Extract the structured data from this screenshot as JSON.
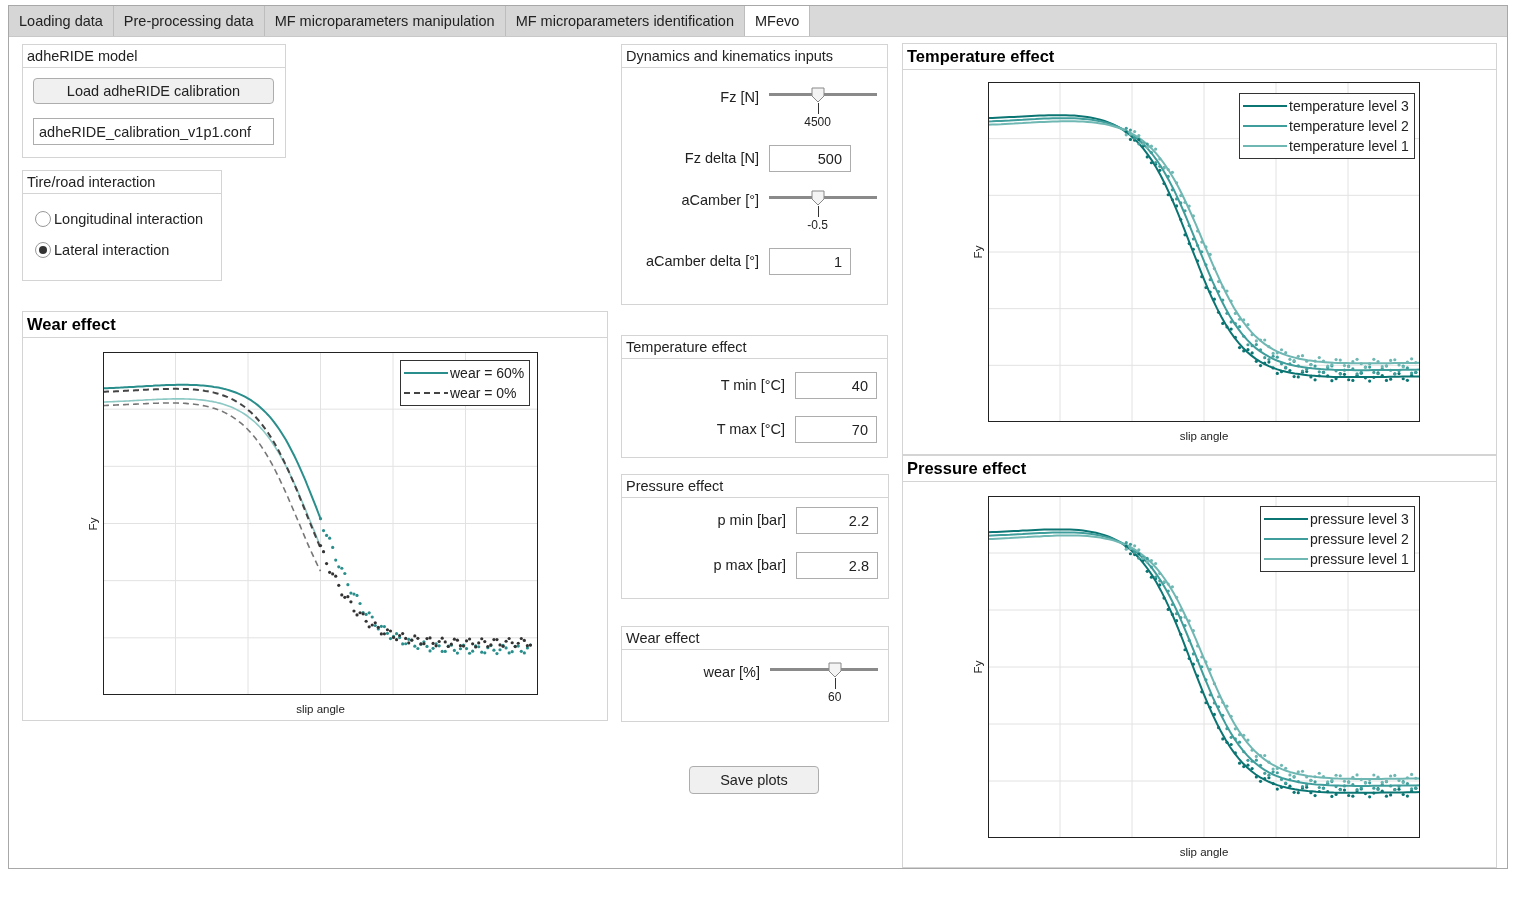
{
  "tabs": [
    {
      "label": "Loading data",
      "selected": false
    },
    {
      "label": "Pre-processing data",
      "selected": false
    },
    {
      "label": "MF microparameters manipulation",
      "selected": false
    },
    {
      "label": "MF microparameters identification",
      "selected": false
    },
    {
      "label": "MFevo",
      "selected": true
    }
  ],
  "model_panel": {
    "title": "adheRIDE model",
    "button": "Load adheRIDE calibration",
    "file_field": "adheRIDE_calibration_v1p1.conf"
  },
  "interaction_panel": {
    "title": "Tire/road interaction",
    "options": [
      {
        "label": "Longitudinal interaction",
        "selected": false
      },
      {
        "label": "Lateral interaction",
        "selected": true
      }
    ]
  },
  "wear_chart": {
    "title": "Wear effect",
    "ylabel": "Fy",
    "xlabel": "slip angle",
    "legend": [
      {
        "label": "wear = 60%",
        "kind": "solid",
        "color": "#2a8f8c"
      },
      {
        "label": "wear = 0%",
        "kind": "dashed",
        "color": "#444444"
      }
    ]
  },
  "dynamics_panel": {
    "title": "Dynamics and kinematics inputs",
    "inputs": [
      {
        "kind": "slider",
        "label": "Fz [N]",
        "level": 0.45,
        "reading": "4500"
      },
      {
        "kind": "field",
        "label": "Fz delta [N]",
        "value": "500"
      },
      {
        "kind": "slider",
        "label": "aCamber [°]",
        "level": 0.45,
        "reading": "-0.5"
      },
      {
        "kind": "field",
        "label": "aCamber delta [°]",
        "value": "1"
      }
    ]
  },
  "temperature_panel": {
    "title": "Temperature effect",
    "inputs": [
      {
        "kind": "field",
        "label": "T min [°C]",
        "value": "40"
      },
      {
        "kind": "field",
        "label": "T max [°C]",
        "value": "70"
      }
    ]
  },
  "pressure_panel": {
    "title": "Pressure effect",
    "inputs": [
      {
        "kind": "field",
        "label": "p min [bar]",
        "value": "2.2"
      },
      {
        "kind": "field",
        "label": "p max [bar]",
        "value": "2.8"
      }
    ]
  },
  "wear_panel": {
    "title": "Wear effect",
    "inputs": [
      {
        "kind": "slider",
        "label": "wear [%]",
        "level": 0.6,
        "reading": "60"
      }
    ]
  },
  "save_button": "Save plots",
  "temperature_chart": {
    "title": "Temperature effect",
    "ylabel": "Fy",
    "xlabel": "slip angle",
    "legend": [
      {
        "label": "temperature level 3",
        "kind": "solid",
        "color": "#0b7573"
      },
      {
        "label": "temperature level 2",
        "kind": "solid",
        "color": "#3f9e9b"
      },
      {
        "label": "temperature level 1",
        "kind": "solid",
        "color": "#6fb7b3"
      }
    ]
  },
  "pressure_chart": {
    "title": "Pressure effect",
    "ylabel": "Fy",
    "xlabel": "slip angle",
    "legend": [
      {
        "label": "pressure level 3",
        "kind": "solid",
        "color": "#0b7573"
      },
      {
        "label": "pressure level 2",
        "kind": "solid",
        "color": "#3f9e9b"
      },
      {
        "label": "pressure level 1",
        "kind": "solid",
        "color": "#6fb7b3"
      }
    ]
  }
}
